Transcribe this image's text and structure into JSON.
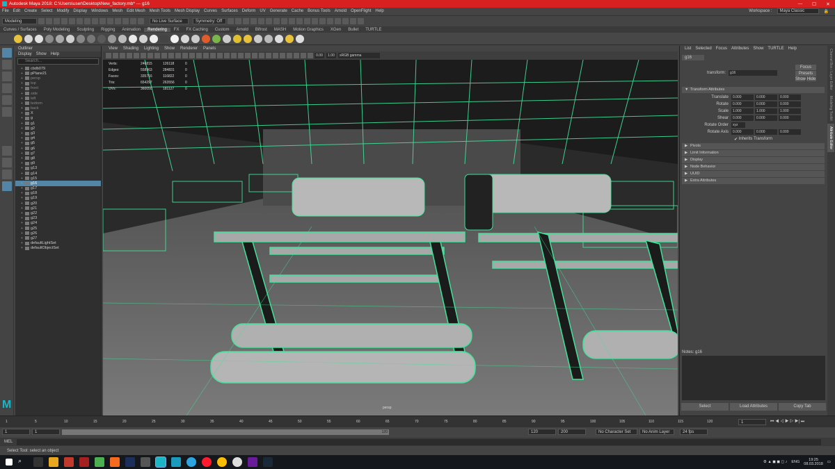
{
  "titlebar": {
    "title": "Autodesk Maya 2018: C:\\Users\\user\\Desktop\\New_factory.mb* --- g16"
  },
  "menubar": {
    "items": [
      "File",
      "Edit",
      "Create",
      "Select",
      "Modify",
      "Display",
      "Windows",
      "Mesh",
      "Edit Mesh",
      "Mesh Tools",
      "Mesh Display",
      "Curves",
      "Surfaces",
      "Deform",
      "UV",
      "Generate",
      "Cache",
      "Bonus Tools",
      "Arnold",
      "OpenFlight",
      "Help"
    ],
    "workspace_label": "Workspace :",
    "workspace": "Maya Classic"
  },
  "statusline": {
    "mode": "Modeling",
    "live_surface": "No Live Surface",
    "symmetry": "Symmetry: Off"
  },
  "shelf": {
    "tabs": [
      "Curves / Surfaces",
      "Poly Modeling",
      "Sculpting",
      "Rigging",
      "Animation",
      "Rendering",
      "FX",
      "FX Caching",
      "Custom",
      "Arnold",
      "Bifrost",
      "MASH",
      "Motion Graphics",
      "XGen",
      "Bullet",
      "TURTLE"
    ],
    "active": "Rendering",
    "icon_colors": [
      "#e8c23a",
      "#d6d6d6",
      "#e0e0e0",
      "#8a8a8a",
      "#a8a8a8",
      "#d0d0d0",
      "#888",
      "#777",
      "#5a5a5a",
      "#9a9a9a",
      "#bbb",
      "#e8e8e8",
      "#d2d2d2",
      "#eee",
      "#444",
      "#f2f2f2",
      "#d8d8d8",
      "#ccc",
      "#e05c2a",
      "#7ab649",
      "#ccc",
      "#e0c030",
      "#e8c23a",
      "#ccc",
      "#bbb",
      "#ddd",
      "#e8c23a",
      "#ddd"
    ]
  },
  "outliner": {
    "title": "Outliner",
    "menu": [
      "Display",
      "Show",
      "Help"
    ],
    "search_placeholder": "Search...",
    "items": [
      {
        "label": "cbdb079",
        "dim": false
      },
      {
        "label": "pPlane21",
        "dim": false
      },
      {
        "label": "persp",
        "dim": true
      },
      {
        "label": "top",
        "dim": true
      },
      {
        "label": "front",
        "dim": true
      },
      {
        "label": "side",
        "dim": true
      },
      {
        "label": "left",
        "dim": true
      },
      {
        "label": "bottom",
        "dim": true
      },
      {
        "label": "back",
        "dim": true
      },
      {
        "label": "X",
        "dim": false
      },
      {
        "label": "g",
        "dim": false
      },
      {
        "label": "g1",
        "dim": false
      },
      {
        "label": "g2",
        "dim": false
      },
      {
        "label": "g3",
        "dim": false
      },
      {
        "label": "g4",
        "dim": false
      },
      {
        "label": "g5",
        "dim": false
      },
      {
        "label": "g6",
        "dim": false
      },
      {
        "label": "g7",
        "dim": false
      },
      {
        "label": "g8",
        "dim": false
      },
      {
        "label": "g9",
        "dim": false
      },
      {
        "label": "g13",
        "dim": false
      },
      {
        "label": "g14",
        "dim": false
      },
      {
        "label": "g15",
        "dim": false
      },
      {
        "label": "g16",
        "dim": false,
        "selected": true
      },
      {
        "label": "g17",
        "dim": false
      },
      {
        "label": "g18",
        "dim": false
      },
      {
        "label": "g19",
        "dim": false
      },
      {
        "label": "g20",
        "dim": false
      },
      {
        "label": "g21",
        "dim": false
      },
      {
        "label": "g22",
        "dim": false
      },
      {
        "label": "g23",
        "dim": false
      },
      {
        "label": "g24",
        "dim": false
      },
      {
        "label": "g25",
        "dim": false
      },
      {
        "label": "g26",
        "dim": false
      },
      {
        "label": "g27",
        "dim": false
      },
      {
        "label": "defaultLightSet",
        "dim": false
      },
      {
        "label": "defaultObjectSet",
        "dim": false
      }
    ]
  },
  "viewport": {
    "menu": [
      "View",
      "Shading",
      "Lighting",
      "Show",
      "Renderer",
      "Panels"
    ],
    "near": "0.00",
    "far": "1.00",
    "colorspace": "sRGB gamma",
    "hud": [
      {
        "k": "Verts:",
        "a": "246815",
        "b": "126118",
        "c": "0"
      },
      {
        "k": "Edges:",
        "a": "558963",
        "b": "284831",
        "c": "0"
      },
      {
        "k": "Faces:",
        "a": "335716",
        "b": "116822",
        "c": "0"
      },
      {
        "k": "Tris:",
        "a": "654297",
        "b": "263556",
        "c": "0"
      },
      {
        "k": "UVs:",
        "a": "360050",
        "b": "181127",
        "c": "0"
      }
    ],
    "camera": "persp"
  },
  "attr": {
    "menu": [
      "List",
      "Selected",
      "Focus",
      "Attributes",
      "Show",
      "TURTLE",
      "Help"
    ],
    "node": "g16",
    "transform_label": "transform:",
    "transform": "g16",
    "focus": "Focus",
    "presets": "Presets",
    "show": "Show",
    "hide": "Hide",
    "section": "Transform Attributes",
    "rows": [
      {
        "label": "Translate",
        "v": [
          "0.000",
          "0.000",
          "0.000"
        ]
      },
      {
        "label": "Rotate",
        "v": [
          "0.000",
          "0.000",
          "0.000"
        ]
      },
      {
        "label": "Scale",
        "v": [
          "1.000",
          "1.000",
          "1.000"
        ]
      },
      {
        "label": "Shear",
        "v": [
          "0.000",
          "0.000",
          "0.000"
        ]
      }
    ],
    "rotate_order_label": "Rotate Order",
    "rotate_order": "xyz",
    "rotate_axis": {
      "label": "Rotate Axis",
      "v": [
        "0.000",
        "0.000",
        "0.000"
      ]
    },
    "inherits": "Inherits Transform",
    "sections": [
      "Pivots",
      "Limit Information",
      "Display",
      "Node Behavior",
      "UUID",
      "Extra Attributes"
    ],
    "notes": "Notes: g16",
    "buttons": [
      "Select",
      "Load Attributes",
      "Copy Tab"
    ]
  },
  "sidetabs": [
    "Channel Box / Layer Editor",
    "Modeling Toolkit",
    "Attribute Editor"
  ],
  "timeslider": {
    "ticks": [
      "1",
      "5",
      "10",
      "15",
      "20",
      "25",
      "30",
      "35",
      "40",
      "45",
      "50",
      "55",
      "60",
      "65",
      "70",
      "75",
      "80",
      "85",
      "90",
      "95",
      "100",
      "105",
      "110",
      "115",
      "120"
    ],
    "current": "1"
  },
  "range": {
    "start": "1",
    "start2": "1",
    "mid": "120",
    "end": "120",
    "end2": "200",
    "character": "No Character Set",
    "anim": "No Anim Layer",
    "fps": "24 fps"
  },
  "cmdline": {
    "label": "MEL"
  },
  "helpline": {
    "text": "Select Tool: select an object"
  },
  "taskbar": {
    "lang": "ENG",
    "time": "19:25",
    "date": "08.03.2018"
  }
}
